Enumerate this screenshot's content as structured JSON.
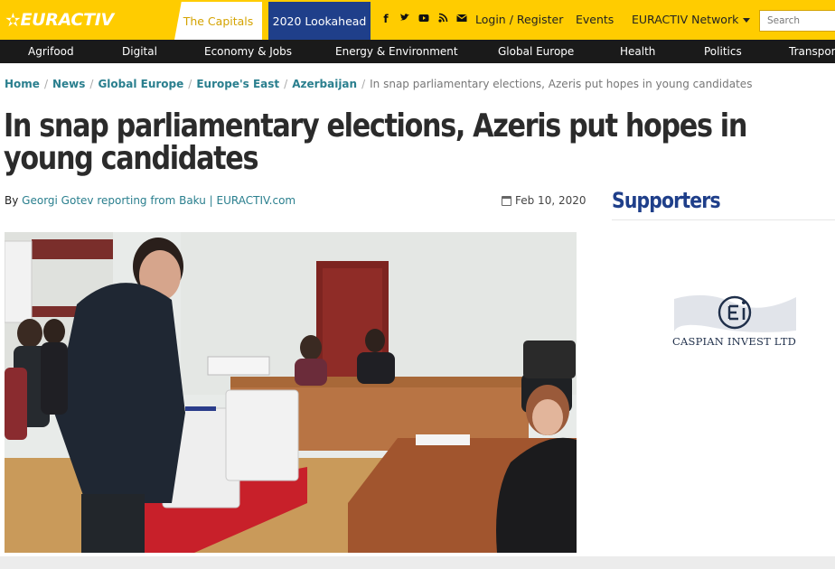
{
  "header": {
    "logo_text": "EURACTIV",
    "tab_capitals": "The Capitals",
    "tab_lookahead": "2020 Lookahead",
    "social_icons": [
      "facebook-icon",
      "twitter-icon",
      "youtube-icon",
      "rss-icon",
      "mail-icon"
    ],
    "login": "Login / Register",
    "events": "Events",
    "network": "EURACTIV Network",
    "search_placeholder": "Search"
  },
  "nav": {
    "items": [
      "Agrifood",
      "Digital",
      "Economy & Jobs",
      "Energy & Environment",
      "Global Europe",
      "Health",
      "Politics",
      "Transport"
    ]
  },
  "breadcrumb": {
    "items": [
      "Home",
      "News",
      "Global Europe",
      "Europe's East",
      "Azerbaijan"
    ],
    "current": "In snap parliamentary elections, Azeris put hopes in young candidates"
  },
  "article": {
    "title": "In snap parliamentary elections, Azeris put hopes in young candidates",
    "byline_prefix": "By",
    "author": "Georgi Gotev reporting from Baku | EURACTIV.com",
    "date": "Feb 10, 2020"
  },
  "sidebar": {
    "heading": "Supporters",
    "sponsor_name": "CASPIAN INVEST LTD"
  },
  "colors": {
    "brand_yellow": "#ffcc00",
    "brand_blue": "#1f3f8a",
    "link_teal": "#2a7f8e",
    "nav_bg": "#1a1a1a"
  }
}
